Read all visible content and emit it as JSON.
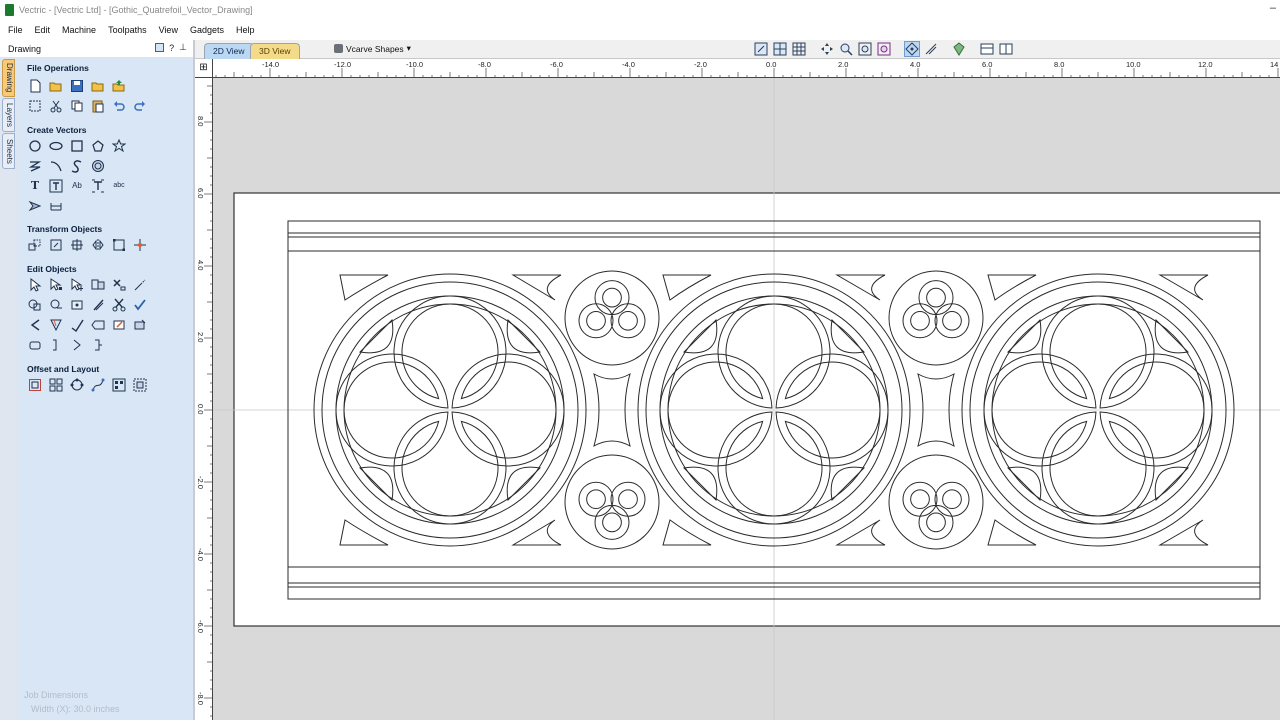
{
  "window": {
    "title": "Vectric - [Vectric Ltd] - [Gothic_Quatrefoil_Vector_Drawing]"
  },
  "menu": [
    "File",
    "Edit",
    "Machine",
    "Toolpaths",
    "View",
    "Gadgets",
    "Help"
  ],
  "panel": {
    "title": "Drawing",
    "side_tabs": [
      "Drawing",
      "Layers",
      "Sheets"
    ],
    "sections": {
      "file_operations": "File Operations",
      "create_vectors": "Create Vectors",
      "transform_objects": "Transform Objects",
      "edit_objects": "Edit Objects",
      "offset_layout": "Offset and Layout"
    },
    "job_dimensions": {
      "label": "Job Dimensions",
      "width": "Width  (X): 30.0 inches"
    }
  },
  "view_tabs": {
    "tab_2d": "2D View",
    "tab_3d": "3D View",
    "vcarve": "Vcarve Shapes"
  },
  "ruler": {
    "top_labels": [
      "-14.0",
      "-12.0",
      "-10.0",
      "-8.0",
      "-6.0",
      "-4.0",
      "-2.0",
      "0.0",
      "2.0",
      "4.0",
      "6.0",
      "8.0",
      "10.0",
      "12.0",
      "14"
    ],
    "left_labels": [
      "8.0",
      "6.0",
      "4.0",
      "2.0",
      "0.0",
      "-2.0",
      "-4.0",
      "-6.0",
      "-8.0"
    ]
  },
  "colors": {
    "panel_bg": "#d8e6f5",
    "canvas_bg": "#d9d9d9",
    "tab_2d": "#bcd7f2",
    "tab_3d": "#f4db8a",
    "icon_stroke": "#20324d"
  }
}
